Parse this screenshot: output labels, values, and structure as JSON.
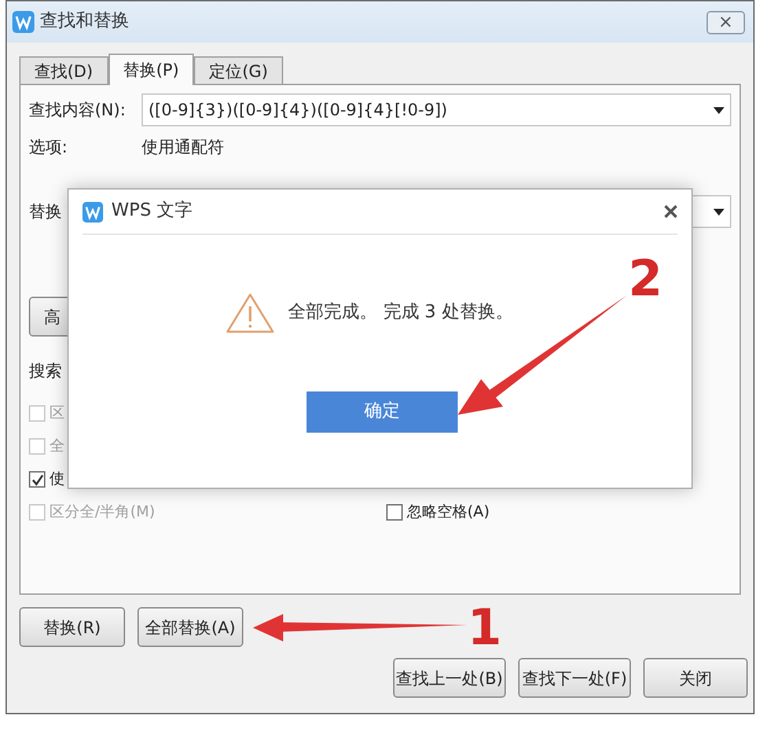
{
  "window": {
    "title": "查找和替换",
    "close": "×"
  },
  "tabs": [
    {
      "label": "查找(D)",
      "selected": false
    },
    {
      "label": "替换(P)",
      "selected": true
    },
    {
      "label": "定位(G)",
      "selected": false
    }
  ],
  "find": {
    "label": "查找内容(N):",
    "value": "([0-9]{3})([0-9]{4})([0-9]{4}[!0-9])"
  },
  "options": {
    "label": "选项:",
    "value": "使用通配符"
  },
  "replace": {
    "label": "替换"
  },
  "advanced_button": "高",
  "search_label": "搜索",
  "checkboxes": [
    {
      "label": "区",
      "checked": false,
      "disabled": true
    },
    {
      "label": "全",
      "checked": false,
      "disabled": true
    },
    {
      "label": "使",
      "checked": true,
      "disabled": false
    }
  ],
  "last_row": [
    {
      "label": "区分全/半角(M)",
      "checked": false,
      "disabled": true
    },
    {
      "label": "忽略空格(A)",
      "checked": false,
      "disabled": false
    }
  ],
  "action_buttons": [
    "替换(R)",
    "全部替换(A)"
  ],
  "nav_buttons": [
    "查找上一处(B)",
    "查找下一处(F)",
    "关闭"
  ],
  "dialog": {
    "title": "WPS 文字",
    "message": "全部完成。 完成 3 处替换。",
    "ok": "确定"
  },
  "annotations": [
    {
      "number": "1"
    },
    {
      "number": "2"
    }
  ]
}
